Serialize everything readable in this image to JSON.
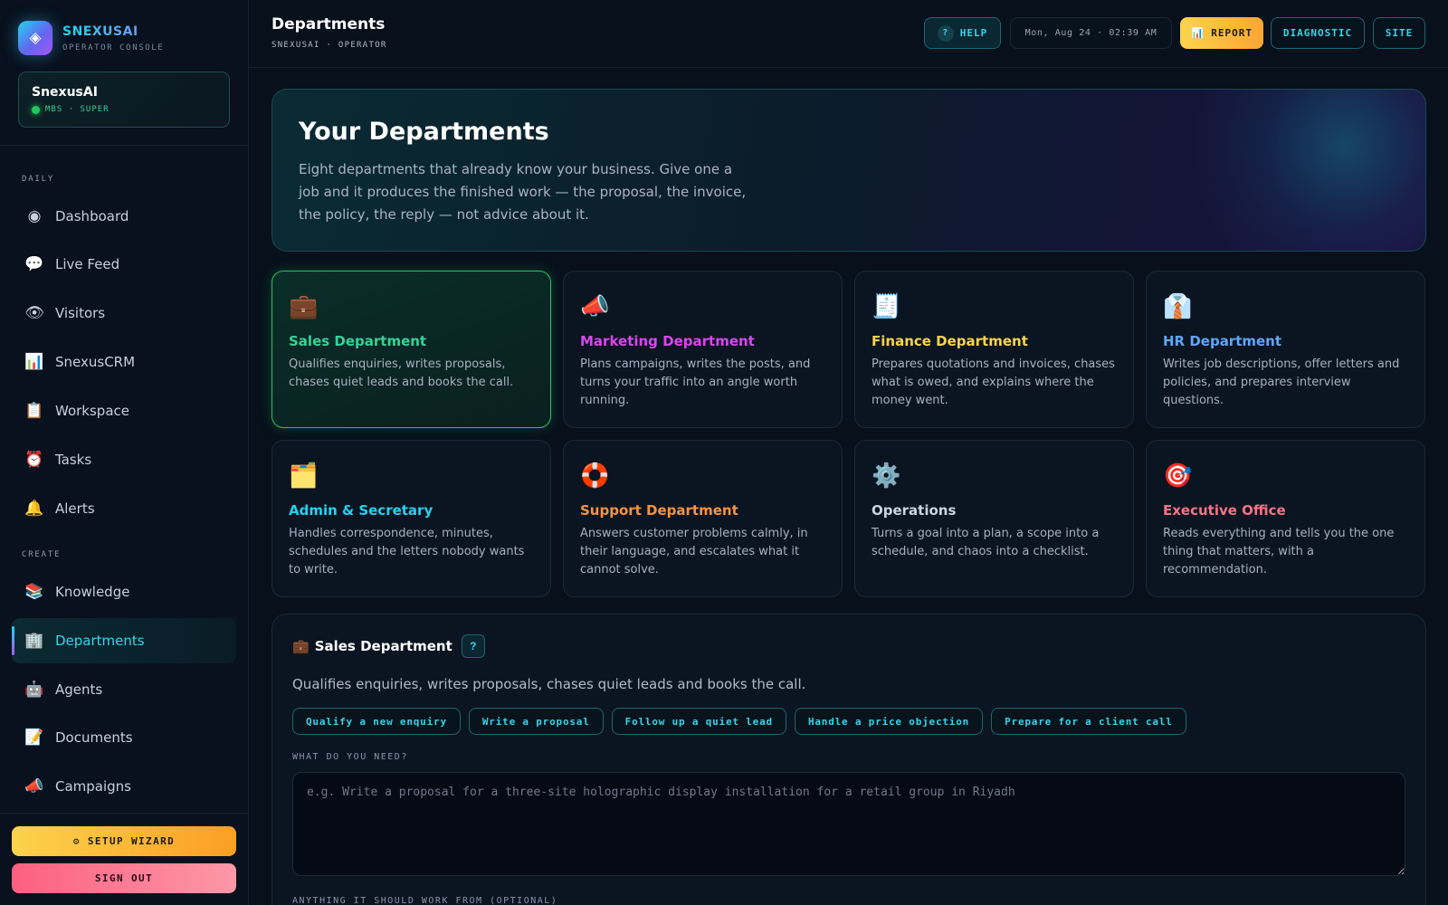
{
  "brand": {
    "logo_glyph": "◈",
    "name": "SNEXUSAI",
    "subtitle": "OPERATOR CONSOLE"
  },
  "account": {
    "name": "SnexusAI",
    "meta": "MBS · SUPER",
    "status_color": "#22c55e"
  },
  "sidebar": {
    "sections": [
      {
        "label": "DAILY",
        "items": [
          {
            "icon": "◉",
            "icon_name": "dashboard-icon",
            "label": "Dashboard"
          },
          {
            "icon": "💬",
            "icon_name": "speech-bubble-icon",
            "label": "Live Feed"
          },
          {
            "icon": "👁",
            "icon_name": "eye-icon",
            "label": "Visitors"
          },
          {
            "icon": "📊",
            "icon_name": "bar-chart-icon",
            "label": "SnexusCRM"
          },
          {
            "icon": "📋",
            "icon_name": "clipboard-icon",
            "label": "Workspace"
          },
          {
            "icon": "⏰",
            "icon_name": "alarm-clock-icon",
            "label": "Tasks"
          },
          {
            "icon": "🔔",
            "icon_name": "bell-icon",
            "label": "Alerts"
          }
        ]
      },
      {
        "label": "CREATE",
        "items": [
          {
            "icon": "📚",
            "icon_name": "books-icon",
            "label": "Knowledge"
          },
          {
            "icon": "🏢",
            "icon_name": "office-building-icon",
            "label": "Departments",
            "active": true
          },
          {
            "icon": "🤖",
            "icon_name": "robot-icon",
            "label": "Agents"
          },
          {
            "icon": "📝",
            "icon_name": "memo-icon",
            "label": "Documents"
          },
          {
            "icon": "📣",
            "icon_name": "megaphone-icon",
            "label": "Campaigns"
          }
        ]
      }
    ],
    "setup_label": "⚙ SETUP WIZARD",
    "signout_label": "SIGN OUT"
  },
  "header": {
    "title": "Departments",
    "subtitle": "SNEXUSAI · OPERATOR",
    "help_glyph": "?",
    "help_label": "HELP",
    "datetime": "Mon, Aug 24 · 02:39 AM",
    "report_label": "📊 REPORT",
    "diagnostic_label": "DIAGNOSTIC",
    "site_label": "SITE"
  },
  "hero": {
    "title": "Your Departments",
    "text": "Eight departments that already know your business. Give one a job and it produces the finished work — the proposal, the invoice, the policy, the reply — not advice about it."
  },
  "departments": [
    {
      "icon": "💼",
      "icon_name": "briefcase-icon",
      "name": "Sales Department",
      "color": "#34d399",
      "desc": "Qualifies enquiries, writes proposals, chases quiet leads and books the call.",
      "selected": true
    },
    {
      "icon": "📣",
      "icon_name": "megaphone-icon",
      "name": "Marketing Department",
      "color": "#d946ef",
      "desc": "Plans campaigns, writes the posts, and turns your traffic into an angle worth running."
    },
    {
      "icon": "🧾",
      "icon_name": "receipt-icon",
      "name": "Finance Department",
      "color": "#fcd34d",
      "desc": "Prepares quotations and invoices, chases what is owed, and explains where the money went."
    },
    {
      "icon": "👔",
      "icon_name": "necktie-icon",
      "name": "HR Department",
      "color": "#60a5fa",
      "desc": "Writes job descriptions, offer letters and policies, and prepares interview questions."
    },
    {
      "icon": "🗂️",
      "icon_name": "card-index-icon",
      "name": "Admin & Secretary",
      "color": "#22d3ee",
      "desc": "Handles correspondence, minutes, schedules and the letters nobody wants to write."
    },
    {
      "icon": "🛟",
      "icon_name": "lifebuoy-icon",
      "name": "Support Department",
      "color": "#fb923c",
      "desc": "Answers customer problems calmly, in their language, and escalates what it cannot solve."
    },
    {
      "icon": "⚙️",
      "icon_name": "gear-icon",
      "name": "Operations",
      "color": "#cbd5e1",
      "desc": "Turns a goal into a plan, a scope into a schedule, and chaos into a checklist."
    },
    {
      "icon": "🎯",
      "icon_name": "target-icon",
      "name": "Executive Office",
      "color": "#fb7185",
      "desc": "Reads everything and tells you the one thing that matters, with a recommendation."
    }
  ],
  "detail": {
    "icon": "💼",
    "title": "Sales Department",
    "help_glyph": "?",
    "desc": "Qualifies enquiries, writes proposals, chases quiet leads and books the call.",
    "chips": [
      "Qualify a new enquiry",
      "Write a proposal",
      "Follow up a quiet lead",
      "Handle a price objection",
      "Prepare for a client call"
    ],
    "need_label": "WHAT DO YOU NEED?",
    "need_placeholder": "e.g. Write a proposal for a three-site holographic display installation for a retail group in Riyadh",
    "source_label": "ANYTHING IT SHOULD WORK FROM (OPTIONAL)"
  }
}
